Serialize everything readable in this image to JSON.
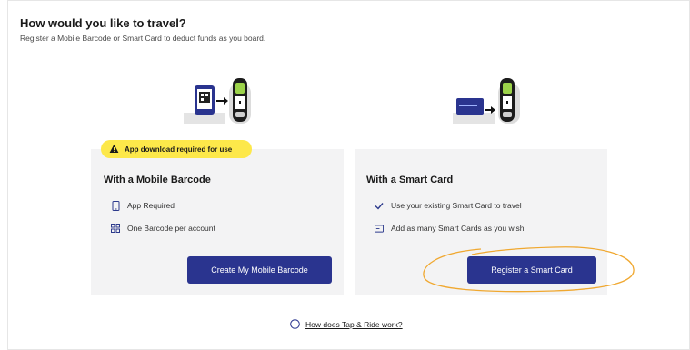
{
  "header": {
    "title": "How would you like to travel?",
    "subtitle": "Register a Mobile Barcode or Smart Card to deduct funds as you board."
  },
  "badge": {
    "label": "App download required for use",
    "icon": "warning-icon",
    "color": "#fde84a"
  },
  "mobile_card": {
    "title": "With a Mobile Barcode",
    "features": [
      {
        "icon": "phone-icon",
        "label": "App Required"
      },
      {
        "icon": "barcode-icon",
        "label": "One Barcode per account"
      }
    ],
    "button_label": "Create My Mobile Barcode"
  },
  "smart_card": {
    "title": "With a Smart Card",
    "features": [
      {
        "icon": "checkmark-icon",
        "label": "Use your existing Smart Card to travel"
      },
      {
        "icon": "card-icon",
        "label": "Add as many Smart Cards as you wish"
      }
    ],
    "button_label": "Register a Smart Card"
  },
  "footer": {
    "link_label": "How does Tap & Ride work?",
    "icon": "info-icon"
  },
  "colors": {
    "primary_button": "#2a348f",
    "card_background": "#f3f3f4",
    "annotation": "#f0a830"
  }
}
